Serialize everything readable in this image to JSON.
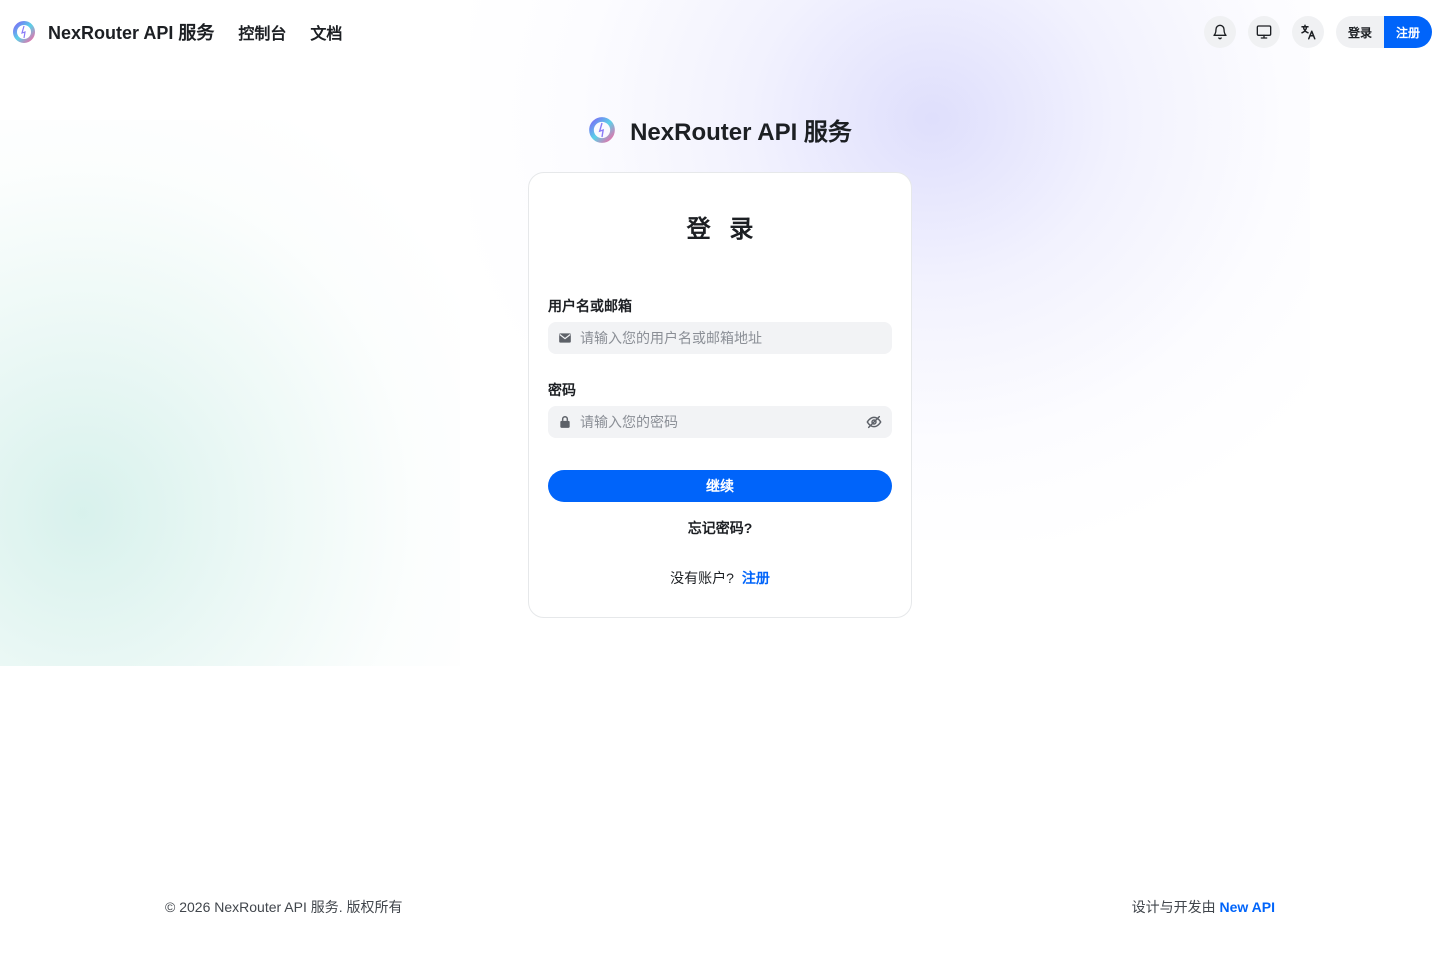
{
  "header": {
    "brand": "NexRouter API 服务",
    "nav": [
      {
        "label": "控制台"
      },
      {
        "label": "文档"
      }
    ],
    "icons": [
      "bell-icon",
      "monitor-icon",
      "translate-icon"
    ],
    "login_label": "登录",
    "register_label": "注册"
  },
  "center_brand": {
    "name": "NexRouter API 服务"
  },
  "login_card": {
    "title": "登 录",
    "username": {
      "label": "用户名或邮箱",
      "placeholder": "请输入您的用户名或邮箱地址",
      "value": "",
      "icon": "mail-icon"
    },
    "password": {
      "label": "密码",
      "placeholder": "请输入您的密码",
      "value": "",
      "icon": "lock-icon",
      "toggle_icon": "eye-off-icon"
    },
    "submit_label": "继续",
    "forgot_label": "忘记密码?",
    "no_account_text": "没有账户?",
    "signup_link": "注册"
  },
  "footer": {
    "copyright": "© 2026 NexRouter API 服务. 版权所有",
    "credit_prefix": "设计与开发由",
    "credit_link": "New API"
  },
  "colors": {
    "primary": "#0064fa",
    "text": "#1c1f23",
    "input_bg": "#f2f3f5",
    "icon_btn_bg": "#f0f1f3"
  }
}
